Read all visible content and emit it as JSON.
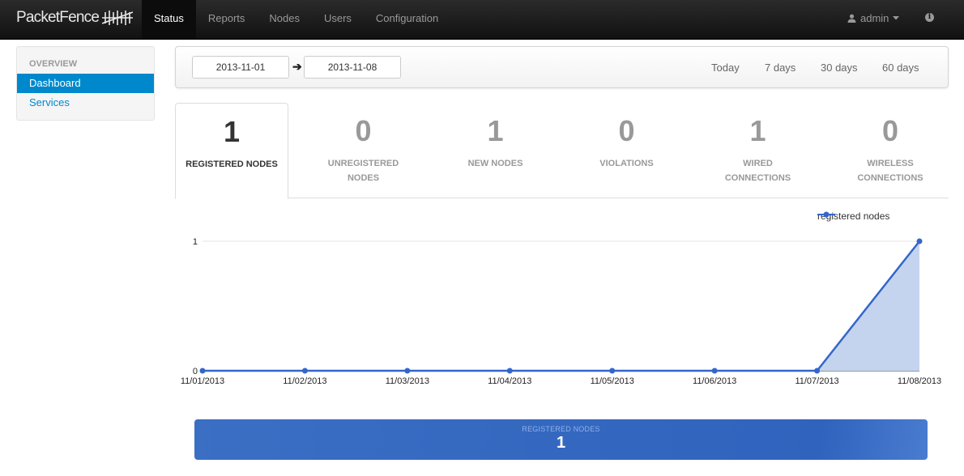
{
  "app": {
    "brand": "PacketFence"
  },
  "nav": {
    "items": [
      {
        "label": "Status",
        "active": true
      },
      {
        "label": "Reports",
        "active": false
      },
      {
        "label": "Nodes",
        "active": false
      },
      {
        "label": "Users",
        "active": false
      },
      {
        "label": "Configuration",
        "active": false
      }
    ],
    "user": "admin"
  },
  "sidebar": {
    "header": "OVERVIEW",
    "items": [
      {
        "label": "Dashboard",
        "active": true
      },
      {
        "label": "Services",
        "active": false
      }
    ]
  },
  "date_range": {
    "start": "2013-11-01",
    "end": "2013-11-08",
    "quick_ranges": [
      "Today",
      "7 days",
      "30 days",
      "60 days"
    ]
  },
  "stats": [
    {
      "value": "1",
      "label": "REGISTERED NODES",
      "active": true
    },
    {
      "value": "0",
      "label": "UNREGISTERED NODES",
      "active": false
    },
    {
      "value": "1",
      "label": "NEW NODES",
      "active": false
    },
    {
      "value": "0",
      "label": "VIOLATIONS",
      "active": false
    },
    {
      "value": "1",
      "label": "WIRED CONNECTIONS",
      "active": false
    },
    {
      "value": "0",
      "label": "WIRELESS CONNECTIONS",
      "active": false
    }
  ],
  "chart_data": {
    "type": "area",
    "title": "",
    "xlabel": "",
    "ylabel": "",
    "x": [
      "11/01/2013",
      "11/02/2013",
      "11/03/2013",
      "11/04/2013",
      "11/05/2013",
      "11/06/2013",
      "11/07/2013",
      "11/08/2013"
    ],
    "series": [
      {
        "name": "registered nodes",
        "values": [
          0,
          0,
          0,
          0,
          0,
          0,
          0,
          1
        ]
      }
    ],
    "yticks": [
      0,
      1
    ],
    "ylim": [
      0,
      1
    ],
    "grid": true,
    "legend": "top-right",
    "colors": {
      "line": "#3366cc",
      "fill": "#c5d4ee"
    }
  },
  "summary": {
    "label": "REGISTERED NODES",
    "value": "1"
  },
  "colors": {
    "accent": "#0088cc",
    "navbar": "#1b1b1b",
    "summary": "#3366cc"
  }
}
